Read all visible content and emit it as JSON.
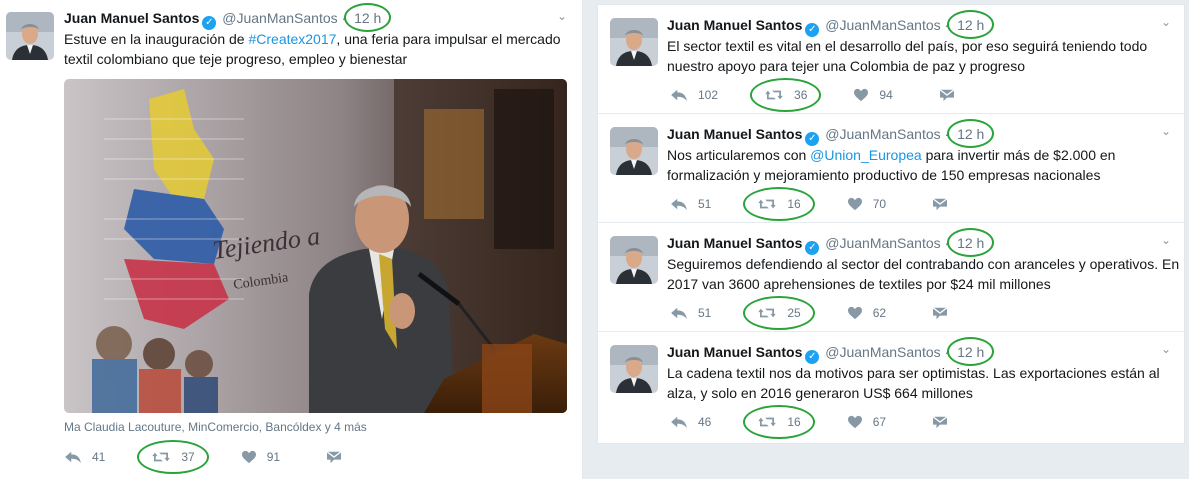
{
  "left_tweet": {
    "name": "Juan Manuel Santos",
    "handle": "@JuanManSantos",
    "time": "12 h",
    "text_before": "Estuve en la inauguración de ",
    "hashtag": "#Createx2017",
    "text_after": ", una feria para impulsar el mercado textil colombiano que teje progreso, empleo y bienestar",
    "photo_text": "Tejiendo a",
    "photo_subtext": "Colombia",
    "caption": "Ma Claudia Lacouture, MinComercio, Bancóldex y 4 más",
    "replies": "41",
    "retweets": "37",
    "likes": "91"
  },
  "right_tweets": [
    {
      "name": "Juan Manuel Santos",
      "handle": "@JuanManSantos",
      "time": "12 h",
      "text": "El sector textil es vital en el desarrollo del país, por eso seguirá teniendo todo nuestro apoyo para tejer una Colombia de paz y progreso",
      "replies": "102",
      "retweets": "36",
      "likes": "94"
    },
    {
      "name": "Juan Manuel Santos",
      "handle": "@JuanManSantos",
      "time": "12 h",
      "text_before": "Nos articularemos con ",
      "mention": "@Union_Europea",
      "text_after": " para invertir más de $2.000 en formalización y mejoramiento productivo de 150 empresas nacionales",
      "replies": "51",
      "retweets": "16",
      "likes": "70"
    },
    {
      "name": "Juan Manuel Santos",
      "handle": "@JuanManSantos",
      "time": "12 h",
      "text": "Seguiremos defendiendo al sector del contrabando con aranceles y operativos. En 2017 van 3600 aprehensiones de textiles por $24 mil millones",
      "replies": "51",
      "retweets": "25",
      "likes": "62"
    },
    {
      "name": "Juan Manuel Santos",
      "handle": "@JuanManSantos",
      "time": "12 h",
      "text": "La cadena textil nos da motivos para ser optimistas. Las exportaciones están al alza, y solo en 2016 generaron US$ 664 millones",
      "replies": "46",
      "retweets": "16",
      "likes": "67"
    }
  ],
  "colors": {
    "verified": "#1da1f2",
    "link": "#1b95e0",
    "annotation": "#2aa33b",
    "muted": "#657786"
  },
  "icons": [
    "avatar",
    "verified-badge-icon",
    "chevron-down-icon",
    "reply-icon",
    "retweet-icon",
    "like-icon",
    "message-icon"
  ]
}
